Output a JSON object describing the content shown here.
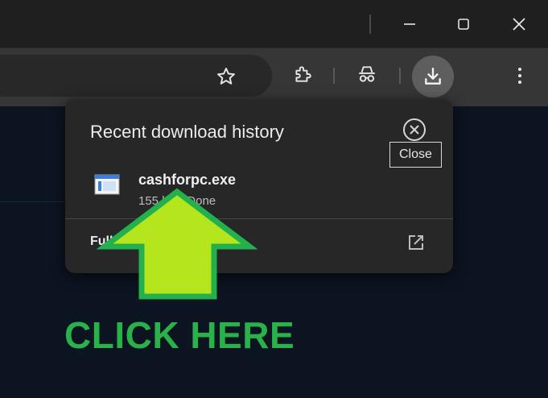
{
  "popup": {
    "title": "Recent download history",
    "item": {
      "file_name": "cashforpc.exe",
      "status": "155 kB • Done"
    },
    "full_history_label": "Full download history",
    "close_tooltip": "Close"
  },
  "overlay": {
    "call_to_action": "CLICK HERE",
    "arrow_color": "#b5e61d",
    "arrow_border_color": "#22b14c"
  },
  "icons": {
    "window_controls": [
      "minimize-icon",
      "maximize-icon",
      "close-icon"
    ],
    "toolbar": [
      "bookmark-star-icon",
      "extensions-icon",
      "incognito-icon",
      "download-icon",
      "more-menu-icon"
    ],
    "popup": [
      "close-circle-icon",
      "exe-file-icon",
      "open-external-icon"
    ]
  },
  "colors": {
    "accent_download_button": "#5e5e5e",
    "popup_bg": "#272727",
    "page_bg": "#0c1421"
  }
}
